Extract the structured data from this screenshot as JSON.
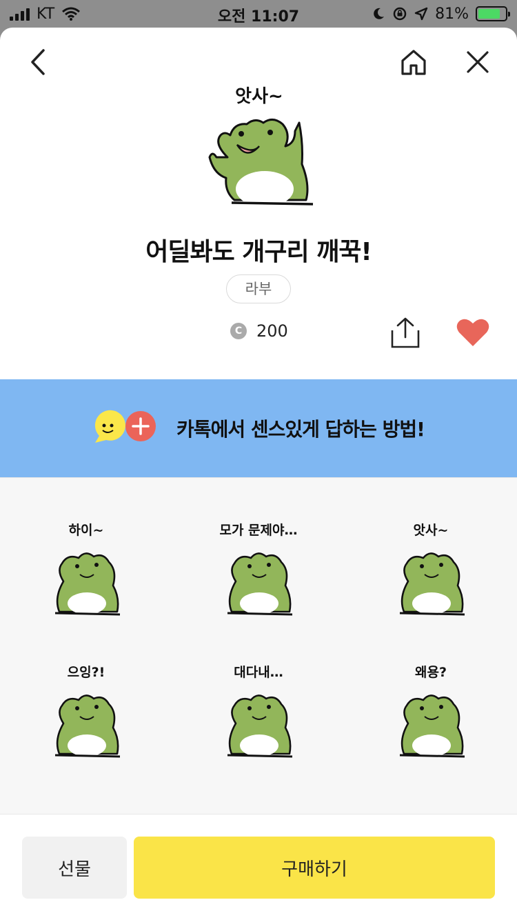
{
  "status_bar": {
    "carrier": "KT",
    "time": "오전 11:07",
    "battery_percent": "81%",
    "battery_level": 0.81
  },
  "nav": {
    "back_icon": "chevron-left-icon",
    "home_icon": "home-icon",
    "close_icon": "close-icon"
  },
  "product": {
    "hero_caption": "앗사~",
    "title": "어딜봐도 개구리 깨꾹!",
    "author": "라부",
    "coin_symbol": "C",
    "price": "200",
    "liked": true,
    "heart_color": "#e8665a"
  },
  "banner": {
    "text": "카톡에서 센스있게 답하는 방법!",
    "background": "#7fb7f2"
  },
  "stickers": [
    {
      "caption": "하이~"
    },
    {
      "caption": "모가 문제야…"
    },
    {
      "caption": "앗사~"
    },
    {
      "caption": "으잉?!"
    },
    {
      "caption": "대다내…"
    },
    {
      "caption": "왜용?"
    },
    {
      "caption": ""
    },
    {
      "caption": ""
    },
    {
      "caption": ""
    }
  ],
  "actions": {
    "gift_label": "선물",
    "buy_label": "구매하기",
    "buy_color": "#fae448"
  }
}
